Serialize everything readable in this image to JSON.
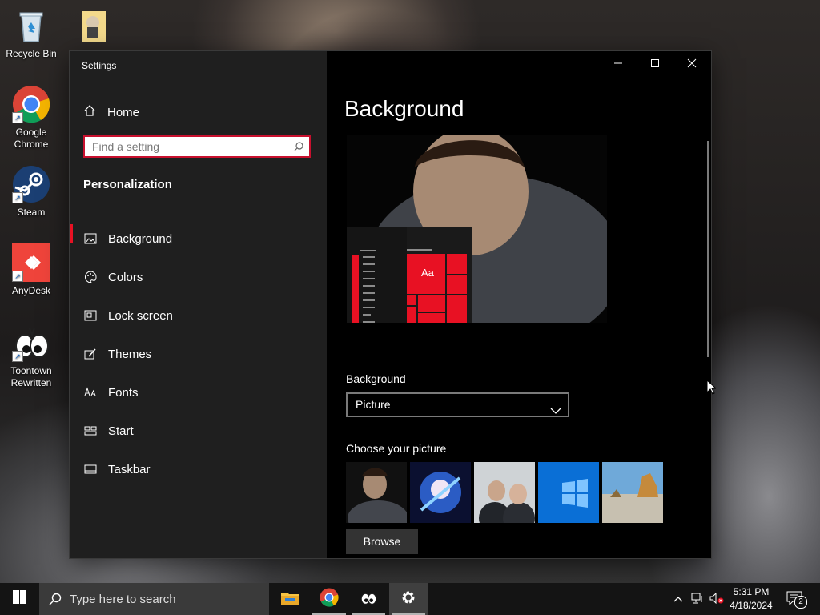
{
  "desktop": {
    "icons": [
      {
        "label": "Recycle Bin",
        "icon": "recycle-bin-icon"
      },
      {
        "label": "",
        "icon": "folder-image-icon"
      },
      {
        "label": "Google Chrome",
        "icon": "chrome-icon"
      },
      {
        "label": "Steam",
        "icon": "steam-icon"
      },
      {
        "label": "AnyDesk",
        "icon": "anydesk-icon"
      },
      {
        "label": "Toontown Rewritten",
        "icon": "toontown-icon"
      }
    ]
  },
  "window": {
    "title": "Settings",
    "controls": {
      "minimize": "minimize-icon",
      "maximize": "maximize-icon",
      "close": "close-icon"
    }
  },
  "sidebar": {
    "home_label": "Home",
    "search_placeholder": "Find a setting",
    "section_title": "Personalization",
    "items": [
      {
        "label": "Background",
        "icon": "picture-icon",
        "active": true
      },
      {
        "label": "Colors",
        "icon": "palette-icon",
        "active": false
      },
      {
        "label": "Lock screen",
        "icon": "lock-screen-icon",
        "active": false
      },
      {
        "label": "Themes",
        "icon": "brush-icon",
        "active": false
      },
      {
        "label": "Fonts",
        "icon": "font-icon",
        "active": false
      },
      {
        "label": "Start",
        "icon": "start-icon",
        "active": false
      },
      {
        "label": "Taskbar",
        "icon": "taskbar-icon",
        "active": false
      }
    ]
  },
  "main": {
    "title": "Background",
    "preview_tile_text": "Aa",
    "background_label": "Background",
    "background_value": "Picture",
    "choose_label": "Choose your picture",
    "browse_label": "Browse"
  },
  "taskbar": {
    "search_placeholder": "Type here to search",
    "time": "5:31 PM",
    "date": "4/18/2024",
    "notification_count": "2"
  },
  "colors": {
    "accent": "#e81123",
    "sidebar_bg": "#1f1f1f",
    "content_bg": "#000000",
    "taskbar_bg": "#141414"
  }
}
